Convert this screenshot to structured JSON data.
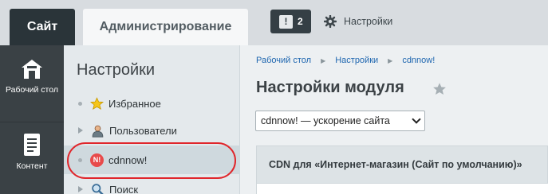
{
  "topbar": {
    "tab_site": "Сайт",
    "tab_admin": "Администрирование",
    "notifications_count": "2",
    "settings_label": "Настройки"
  },
  "left_menu": {
    "items": [
      {
        "label": "Рабочий стол",
        "icon": "home-icon"
      },
      {
        "label": "Контент",
        "icon": "document-icon"
      }
    ]
  },
  "panel": {
    "title": "Настройки",
    "items": [
      {
        "label": "Избранное",
        "icon": "star-icon"
      },
      {
        "label": "Пользователи",
        "icon": "user-icon"
      },
      {
        "label": "cdnnow!",
        "icon": "cdnnow-logo-icon",
        "badge": "N!"
      },
      {
        "label": "Поиск",
        "icon": "search-icon"
      }
    ]
  },
  "main": {
    "breadcrumb": [
      "Рабочий стол",
      "Настройки",
      "cdnnow!"
    ],
    "title": "Настройки модуля",
    "module_select": "cdnnow! — ускорение сайта",
    "site_tab": "CDN для «Интернет-магазин (Сайт по умолчанию)»"
  },
  "colors": {
    "accent_red": "#e0262b",
    "link_blue": "#2067b0",
    "dark_menu": "#3a4145"
  }
}
